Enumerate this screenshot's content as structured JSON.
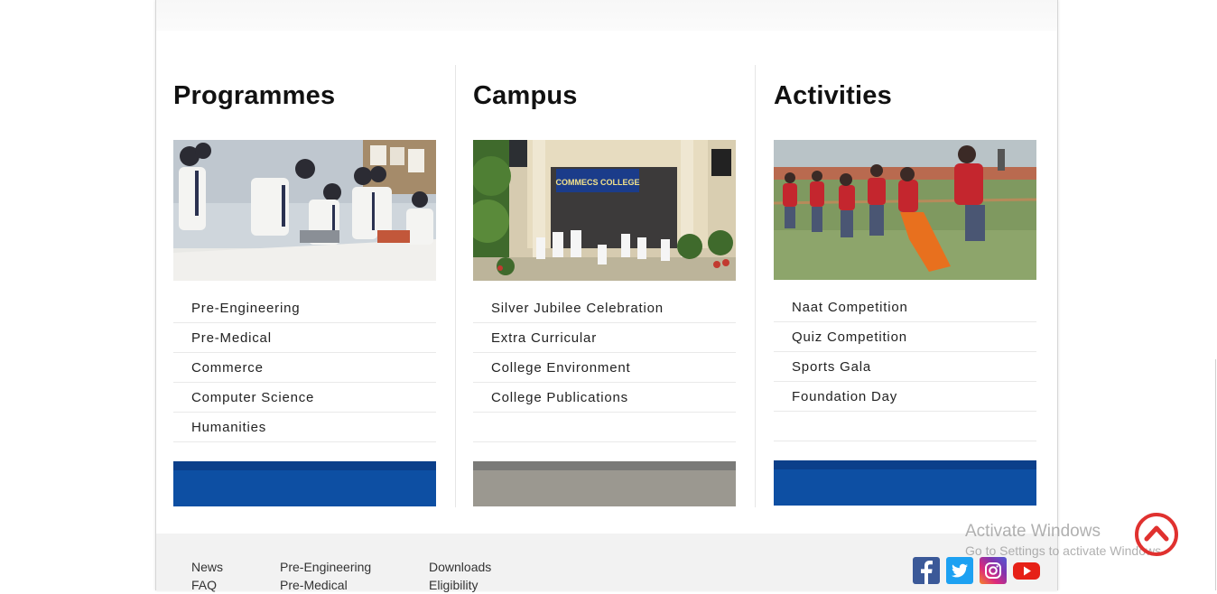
{
  "sections": [
    {
      "title": "Programmes",
      "image_alt": "Students working in a laboratory",
      "links": [
        "Pre-Engineering",
        "Pre-Medical",
        "Commerce",
        "Computer Science",
        "Humanities"
      ],
      "bar_colors": {
        "stripe": "#0b3f8a",
        "fill": "#0d4fa3"
      }
    },
    {
      "title": "Campus",
      "image_alt": "Commecs College building entrance",
      "image_sign": "COMMECS COLLEGE",
      "links": [
        "Silver Jubilee Celebration",
        "Extra Curricular",
        "College Environment",
        "College Publications"
      ],
      "bar_colors": {
        "stripe": "#7a7a78",
        "fill": "#9b9890"
      }
    },
    {
      "title": "Activities",
      "image_alt": "Students playing tug of war",
      "links": [
        "Naat Competition",
        "Quiz Competition",
        "Sports Gala",
        "Foundation Day"
      ],
      "bar_colors": {
        "stripe": "#0b3f8a",
        "fill": "#0d4fa3"
      }
    }
  ],
  "footer": {
    "col1": [
      "News",
      "FAQ"
    ],
    "col2": [
      "Pre-Engineering",
      "Pre-Medical"
    ],
    "col3": [
      "Downloads",
      "Eligibility"
    ],
    "social": [
      {
        "name": "facebook-icon",
        "color": "#3b5998"
      },
      {
        "name": "twitter-icon",
        "color": "#1da1f2"
      },
      {
        "name": "instagram-icon",
        "color": "#c13584"
      },
      {
        "name": "youtube-icon",
        "color": "#e62117"
      }
    ]
  },
  "overlay": {
    "activate_title": "Activate Windows",
    "activate_sub": "Go to Settings to activate Windows."
  },
  "accent": "#e0312f"
}
